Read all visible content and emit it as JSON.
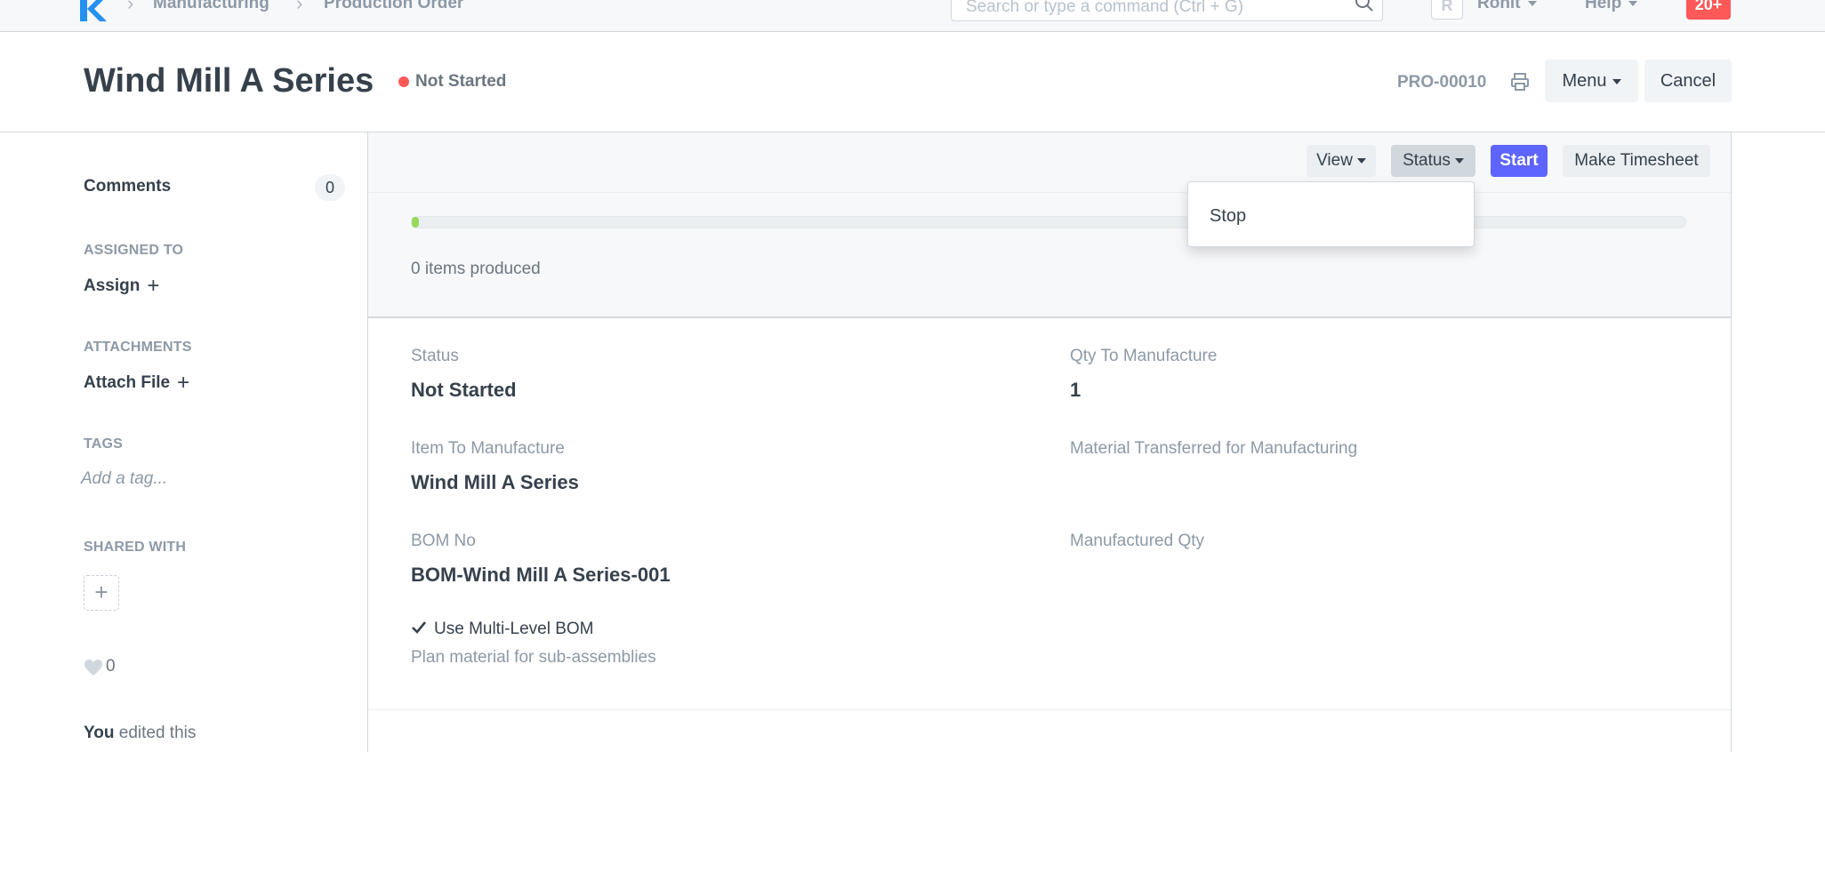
{
  "navbar": {
    "breadcrumbs": [
      "Manufacturing",
      "Production Order"
    ],
    "search_placeholder": "Search or type a command (Ctrl + G)",
    "avatar_initial": "R",
    "user_label": "Rohit",
    "help_label": "Help",
    "notifications_count": "20+"
  },
  "page": {
    "title": "Wind Mill A Series",
    "status_indicator": "Not Started",
    "doc_name": "PRO-00010",
    "menu_label": "Menu",
    "cancel_label": "Cancel"
  },
  "sidebar": {
    "comments_label": "Comments",
    "comments_count": "0",
    "assigned_heading": "ASSIGNED TO",
    "assign_label": "Assign",
    "attachments_heading": "ATTACHMENTS",
    "attach_label": "Attach File",
    "tags_heading": "TAGS",
    "tag_placeholder": "Add a tag...",
    "shared_heading": "SHARED WITH",
    "likes_count": "0",
    "timeline_user": "You",
    "timeline_text": " edited this"
  },
  "toolbar": {
    "view_label": "View",
    "status_label": "Status",
    "start_label": "Start",
    "timesheet_label": "Make Timesheet",
    "status_menu_items": [
      "Stop"
    ]
  },
  "progress": {
    "fraction": 0.0,
    "label": "0 items produced"
  },
  "form": {
    "status_label": "Status",
    "status_value": "Not Started",
    "qty_label": "Qty To Manufacture",
    "qty_value": "1",
    "item_label": "Item To Manufacture",
    "item_value": "Wind Mill A Series",
    "material_label": "Material Transferred for Manufacturing",
    "bom_label": "BOM No",
    "bom_value": "BOM-Wind Mill A Series-001",
    "manufactured_label": "Manufactured Qty",
    "multi_level_label": "Use Multi-Level BOM",
    "multi_level_desc": "Plan material for sub-assemblies"
  },
  "colors": {
    "primary": "#5e64ff",
    "danger": "#ff5858",
    "progress": "#98d85b",
    "logo": "#2490ef"
  }
}
